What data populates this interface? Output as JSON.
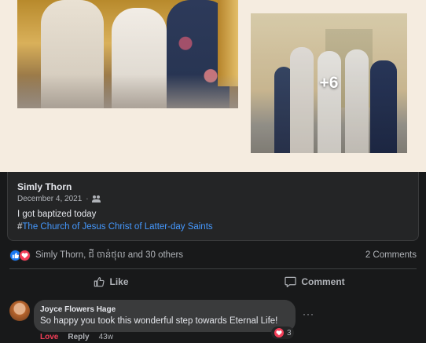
{
  "photos": {
    "more_count": "+6"
  },
  "shared_post": {
    "author": "Simly Thorn",
    "date": "December 4, 2021",
    "privacy_icon": "friends-icon",
    "text": "I got baptized today",
    "hashtag_prefix": "#",
    "hashtag_link": "The Church of Jesus Christ of Latter-day Saints"
  },
  "reactions": {
    "names": "Simly Thorn, ជី ចាន់ថុល and 30 others",
    "comments_count": "2 Comments",
    "icons": [
      "like-icon",
      "love-icon"
    ]
  },
  "actions": {
    "like_label": "Like",
    "comment_label": "Comment"
  },
  "comment": {
    "author": "Joyce Flowers Hage",
    "text": "So happy you took this wonderful step towards Eternal Life!",
    "reaction_count": "3",
    "love_label": "Love",
    "reply_label": "Reply",
    "time": "43w",
    "more": "···"
  },
  "colors": {
    "background": "#18191a",
    "card": "#242526",
    "link": "#4599ff",
    "love": "#f33e58",
    "like": "#1877f2"
  }
}
